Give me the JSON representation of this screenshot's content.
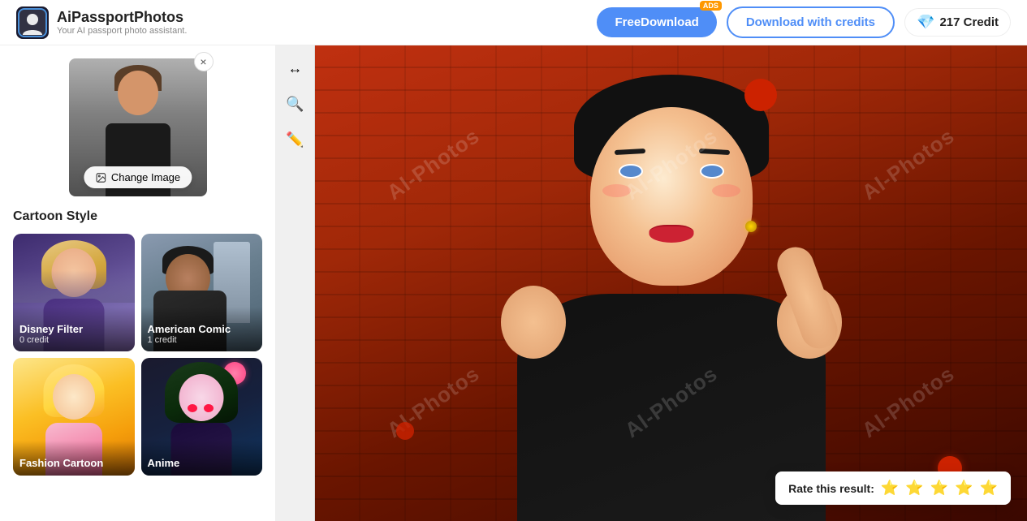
{
  "app": {
    "name": "AiPassportPhotos",
    "tagline": "Your AI passport photo assistant."
  },
  "header": {
    "free_download_label": "FreeDownload",
    "ads_badge": "ADS",
    "download_credits_label": "Download with credits",
    "credits_count": "217 Credit"
  },
  "upload": {
    "change_image_label": "Change Image",
    "close_label": "×"
  },
  "cartoon_style": {
    "section_title": "Cartoon Style",
    "styles": [
      {
        "id": "disney-filter",
        "name": "Disney Filter",
        "credit": "0 credit"
      },
      {
        "id": "american-comic",
        "name": "American Comic",
        "credit": "1 credit"
      },
      {
        "id": "fashion-cartoon",
        "name": "Fashion Cartoon",
        "credit": ""
      },
      {
        "id": "anime",
        "name": "Anime",
        "credit": ""
      }
    ]
  },
  "watermark": {
    "text": "Al-Photos"
  },
  "rate_tooltip": {
    "label": "Rate this result:"
  }
}
